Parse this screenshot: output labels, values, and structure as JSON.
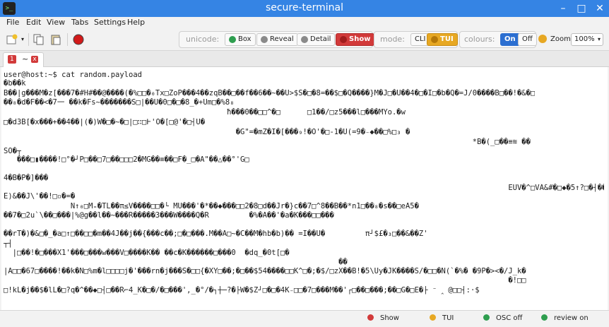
{
  "window": {
    "title": "secure-terminal",
    "minimize": "–",
    "maximize": "□",
    "close": "✕",
    "app_icon": ">_"
  },
  "menu": {
    "file": "File",
    "edit": "Edit",
    "view": "View",
    "tabs": "Tabs",
    "settings": "Settings",
    "help": "Help"
  },
  "toolbar": {
    "unicode_label": "unicode:",
    "box": "Box",
    "reveal": "Reveal",
    "detail": "Detail",
    "show": "Show",
    "mode_label": "mode:",
    "cli": "CLI",
    "tui": "TUI",
    "colours_label": "colours:",
    "on": "On",
    "off": "Off",
    "zoom_label": "Zoom",
    "zoom_value": "100%",
    "colors": {
      "green": "#2e9e4f",
      "grey": "#8a8a8a",
      "red": "#d23a3a",
      "orange": "#e7a823",
      "blue": "#2c6fd1"
    }
  },
  "tab": {
    "number": "1",
    "label": "~",
    "close": "x"
  },
  "terminal": {
    "prompt": "user@host:~$ cat random.payload",
    "lines": [
      "�b��k",
      "B��|g���M�z[���7�#H#��@����(�%□□�₀Tx□ZoP���4��zqB��□��f��6��~��U>$S�□�8=��$□�Q����}M�J□�U��4�□�I□�b�Q�=J/0����B□��!�&�□",
      "��₈�d�F��<�7⼀ ��k�Fs~�������S□|��U�0□�□�8_�+Um□�%8₈",
      "                                                  ħ���0��□□^�□      □1��/□z5���l□���MYo.�w",
      "□�d3B[�x���+��4��|(�)W�□�~�□|□∷□Ͱ'O�[□@'�□┤U�",
      "                                                    �G\"=�mZ�I�[���₉!�O'�□-1�U(=9�₋◆��□%□₃ �",
      "                                                                                                         *B�(_□��≡≋ ��",
      "SO�┬",
      "   ���□▮����!□°�┘P□��□7□��□□□2�MG��≡��□F�_□�A\"��△��°'G□",
      "4�B�P�]���",
      "                                                                                                                 EUV�^□VÃ&#�□◆�5↑?□�┤���·����₃",
      "E)&��J\\'��!□▫�=�",
      "               N↑₀□M₌�TL��π≤V����□□�└ MU���'�*��◆���□□2�8□d��Jr�}c��7□^8��B��*n1□��₈�s��□eA5�",
      "��7�□2u`\\��□���|%@g��l��~���R�����3���W����Q�R         �%�A��'�a�K���□□���",
      "��rT�)�&□�_�a□↑□��□□�m��4J��j��{���c��;□�□���.M��A□~�C��M�hb�b)�� =I��U�         π┘$£�₃□��&��Z'",
      "┬┤",
      "  |□��!�□���X1'���□���w���V□����K�� ��c�K������□���0  �dq_�0t[□�",
      "                                                                           ��",
      "|A□□�67□����!��k�N□%m�l□□□□j�'���rn�j���S�□□{�XY□��;�□��$54����□□K^□�;�$/□zX��B!�5\\Uy�JK����S/�□□�N(`�%� �9P�><�/J_k�",
      "                                                                                                                 �!□□",
      "□!kL�j��$�lL�□?q�^��◆□┤□��R⌐4_K�□�/�□���',_�°/�┐┼─?�├W�$Z┘□�□�4K₋□□�7□���M��'┌□��□���;��□G�□E�├ ⁻ ‸ @□□┤:·$"
    ]
  },
  "status": {
    "show": "Show",
    "tui": "TUI",
    "osc": "OSC off",
    "review": "review on"
  }
}
